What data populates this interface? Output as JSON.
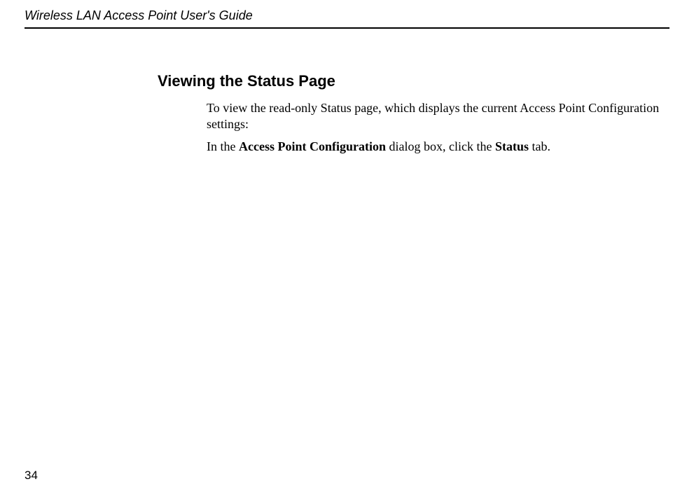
{
  "header": {
    "title": "Wireless LAN Access Point User's Guide"
  },
  "content": {
    "heading": "Viewing the Status Page",
    "para1": "To view the read-only Status page, which displays the current Access Point Configuration settings:",
    "para2_prefix": "In the ",
    "para2_bold1": "Access Point Configuration",
    "para2_mid": " dialog box, click the ",
    "para2_bold2": "Status",
    "para2_suffix": " tab."
  },
  "page_number": "34"
}
